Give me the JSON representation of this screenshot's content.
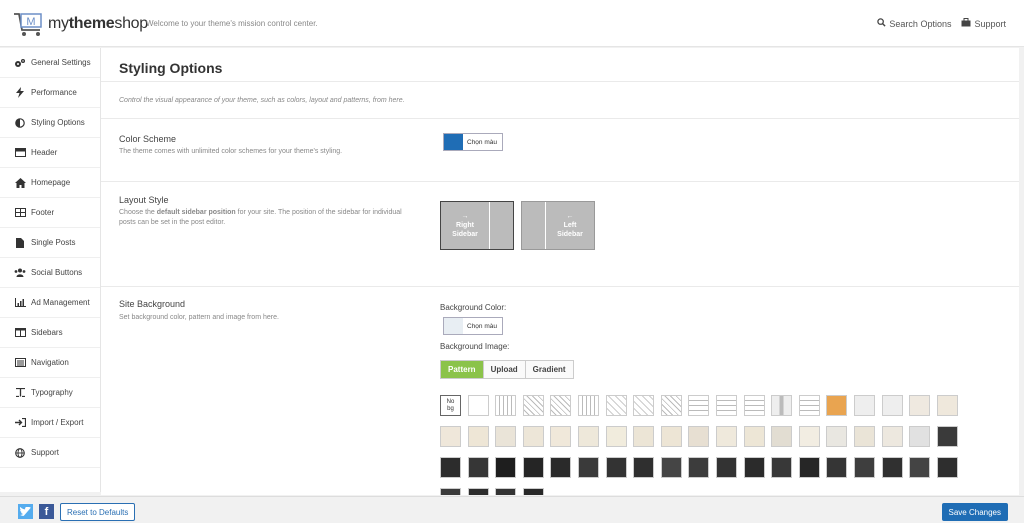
{
  "header": {
    "logo_text_regular": "my",
    "logo_text_bold": "theme",
    "logo_text_tail": "shop",
    "welcome": "Welcome to your theme's mission control center.",
    "search_label": "Search Options",
    "support_label": "Support"
  },
  "sidebar": {
    "items": [
      {
        "label": "General Settings",
        "icon": "gears-icon"
      },
      {
        "label": "Performance",
        "icon": "bolt-icon"
      },
      {
        "label": "Styling Options",
        "icon": "adjust-icon"
      },
      {
        "label": "Header",
        "icon": "header-icon"
      },
      {
        "label": "Homepage",
        "icon": "home-icon"
      },
      {
        "label": "Footer",
        "icon": "footer-icon"
      },
      {
        "label": "Single Posts",
        "icon": "file-icon"
      },
      {
        "label": "Social Buttons",
        "icon": "users-icon"
      },
      {
        "label": "Ad Management",
        "icon": "chart-icon"
      },
      {
        "label": "Sidebars",
        "icon": "columns-icon"
      },
      {
        "label": "Navigation",
        "icon": "list-icon"
      },
      {
        "label": "Typography",
        "icon": "font-icon"
      },
      {
        "label": "Import / Export",
        "icon": "sign-in-icon"
      },
      {
        "label": "Support",
        "icon": "globe-icon"
      }
    ]
  },
  "main": {
    "title": "Styling Options",
    "intro": "Control the visual appearance of your theme, such as colors, layout and patterns, from here.",
    "color_scheme": {
      "title": "Color Scheme",
      "desc": "The theme comes with unlimited color schemes for your theme's styling.",
      "picker_label": "Chọn màu",
      "color": "#1f6db5"
    },
    "layout_style": {
      "title": "Layout Style",
      "desc_pre": "Choose the ",
      "desc_bold": "default sidebar position",
      "desc_post": " for your site. The position of the sidebar for individual posts can be set in the post editor.",
      "right_arrow": "→",
      "right_line1": "Right",
      "right_line2": "Sidebar",
      "left_arrow": "←",
      "left_line1": "Left",
      "left_line2": "Sidebar"
    },
    "site_background": {
      "title": "Site Background",
      "desc": "Set background color, pattern and image from here.",
      "bg_color_label": "Background Color:",
      "picker_label": "Chọn màu",
      "color": "#e8eef3",
      "bg_image_label": "Background Image:",
      "tabs": [
        "Pattern",
        "Upload",
        "Gradient"
      ],
      "no_bg_label_1": "No",
      "no_bg_label_2": "bg"
    }
  },
  "footer": {
    "reset_label": "Reset to Defaults",
    "save_label": "Save Changes",
    "twitter_color": "#55acee",
    "facebook_color": "#3b5998"
  }
}
